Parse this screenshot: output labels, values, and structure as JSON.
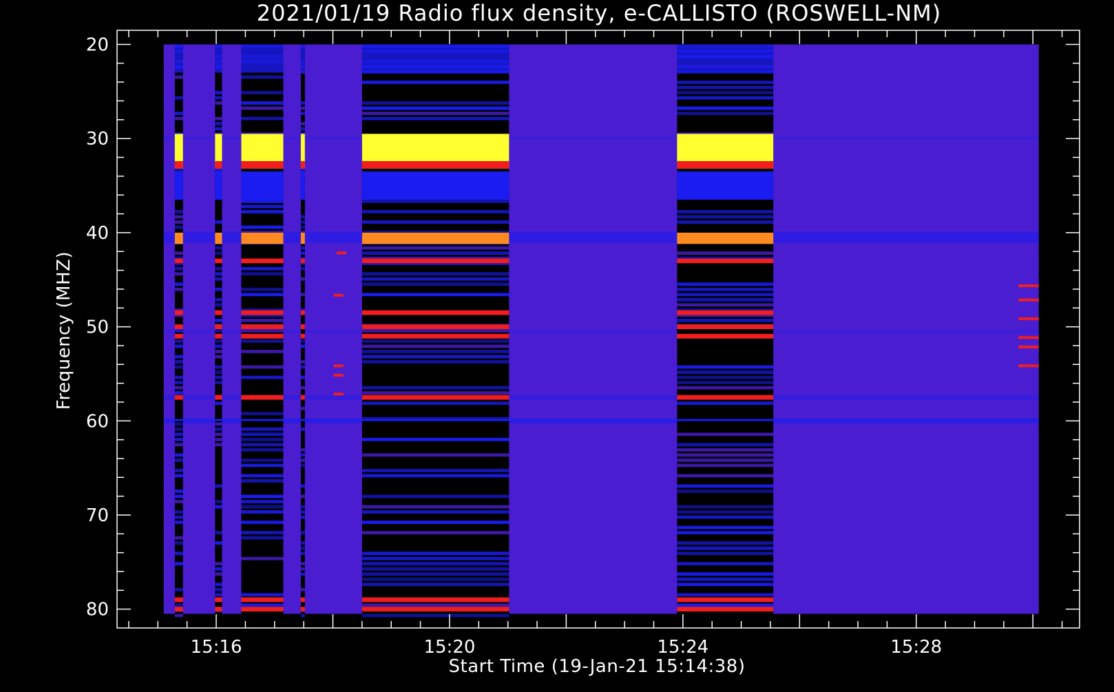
{
  "chart_data": {
    "type": "heatmap",
    "title": "2021/01/19  Radio flux density, e-CALLISTO (ROSWELL-NM)",
    "xlabel": "Start Time (19-Jan-21 15:14:38)",
    "ylabel": "Frequency (MHZ)",
    "x_ticks": [
      {
        "label": "15:16",
        "minutes": 16
      },
      {
        "label": "15:20",
        "minutes": 20
      },
      {
        "label": "15:24",
        "minutes": 24
      },
      {
        "label": "15:28",
        "minutes": 28
      }
    ],
    "y_ticks": [
      20,
      30,
      40,
      50,
      60,
      70,
      80
    ],
    "xlim_minutes": [
      14.3,
      30.8
    ],
    "ylim_mhz": [
      18.5,
      82
    ],
    "data_extent": {
      "t_start_minutes": 15.1,
      "t_end_minutes": 30.1,
      "f_low_mhz": 20,
      "f_high_mhz": 80.5
    },
    "y_inverted": true,
    "colors": {
      "background": "#000000",
      "baseline": "#4a1ed0",
      "blue": "#1a1cf0",
      "red": "#f01e1e",
      "orange": "#ff8a20",
      "yellow": "#ffff30",
      "black": "#000000"
    },
    "high_activity_intervals_minutes": [
      [
        15.29,
        15.43
      ],
      [
        15.98,
        16.1
      ],
      [
        16.43,
        17.15
      ],
      [
        17.45,
        17.52
      ],
      [
        18.5,
        21.02
      ],
      [
        23.9,
        25.55
      ]
    ],
    "strong_band_mhz": [
      29.5,
      33.2
    ],
    "bright_lines_mhz": [
      40.5,
      43,
      48.5,
      50,
      51,
      57.5,
      79,
      80
    ]
  }
}
